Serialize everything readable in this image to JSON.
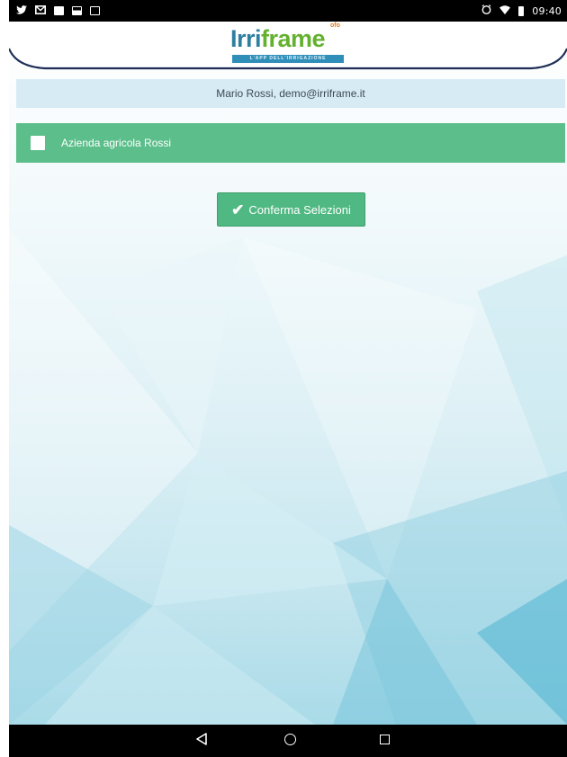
{
  "status_bar": {
    "time": "09:40",
    "left_icons": [
      "twitter-icon",
      "mail-icon",
      "gallery-icon",
      "screenshot-icon",
      "image-icon"
    ],
    "right_icons": [
      "alarm-icon",
      "wifi-icon",
      "battery-icon"
    ]
  },
  "header": {
    "logo_primary": "Irri",
    "logo_accent": "frame",
    "logo_badge": "ofo",
    "logo_subtitle": "L'APP DELL'IRRIGAZIONE"
  },
  "user_bar": {
    "text": "Mario Rossi, demo@irriframe.it"
  },
  "company_list": [
    {
      "label": "Azienda agricola Rossi",
      "checked": false
    }
  ],
  "actions": {
    "confirm_label": "Conferma Selezioni"
  },
  "colors": {
    "accent_green": "#5cbe8a",
    "user_bar_bg": "#d7ebf4",
    "logo_blue": "#2f7fa0",
    "logo_green": "#64b02f"
  }
}
